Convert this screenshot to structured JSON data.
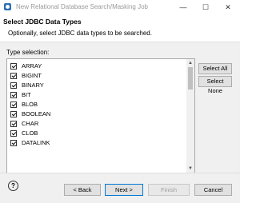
{
  "window": {
    "title": "New Relational Database Search/Masking Job",
    "minimize_glyph": "—",
    "maximize_glyph": "☐",
    "close_glyph": "✕"
  },
  "header": {
    "title": "Select JDBC Data Types",
    "subtitle": "Optionally, select JDBC data types to be searched."
  },
  "selection": {
    "label": "Type selection:",
    "items": [
      {
        "label": "ARRAY",
        "checked": true
      },
      {
        "label": "BIGINT",
        "checked": true
      },
      {
        "label": "BINARY",
        "checked": true
      },
      {
        "label": "BIT",
        "checked": true
      },
      {
        "label": "BLOB",
        "checked": true
      },
      {
        "label": "BOOLEAN",
        "checked": true
      },
      {
        "label": "CHAR",
        "checked": true
      },
      {
        "label": "CLOB",
        "checked": true
      },
      {
        "label": "DATALINK",
        "checked": true
      }
    ],
    "scroll_up_glyph": "▲",
    "scroll_down_glyph": "▼"
  },
  "actions": {
    "select_all": "Select All",
    "select_none": "Select None"
  },
  "footer": {
    "help_glyph": "?",
    "back": "< Back",
    "next": "Next >",
    "finish": "Finish",
    "cancel": "Cancel"
  }
}
